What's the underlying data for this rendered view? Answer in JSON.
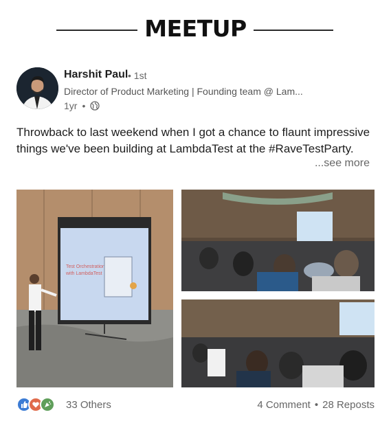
{
  "header": {
    "title": "MEETUP"
  },
  "author": {
    "name": "Harshit Paul",
    "degree": "• 1st",
    "headline": "Director of Product Marketing | Founding team @ Lam...",
    "time": "1yr",
    "time_separator": "•",
    "visibility_icon": "globe-icon"
  },
  "post": {
    "text": "Throwback to last weekend when I got a chance to flaunt impressive things we've been building at LambdaTest at the #RaveTestParty.",
    "see_more": "...see more",
    "slide_text": "Test Orchestration with LambdaTest"
  },
  "footer": {
    "reaction_icons": [
      "like-icon",
      "love-icon",
      "celebrate-icon"
    ],
    "others": "33 Others",
    "comments": "4 Comment",
    "stats_separator": "•",
    "reposts": "28 Reposts"
  },
  "colors": {
    "like": "#3b7bd4",
    "love": "#e06b4b",
    "celebrate": "#5f9e5a"
  }
}
